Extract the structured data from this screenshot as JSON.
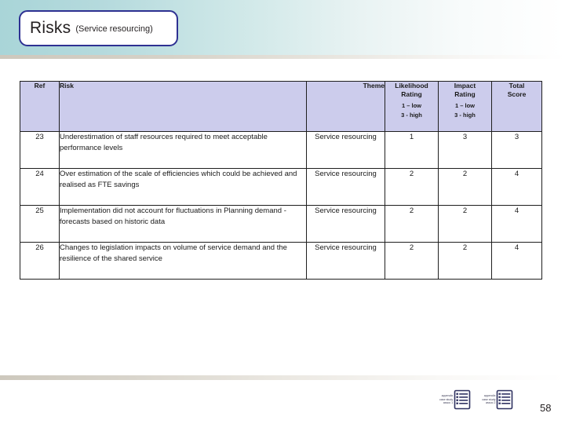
{
  "slide": {
    "title_main": "Risks",
    "title_sub": "(Service resourcing)",
    "page_number": "58",
    "accent_border": "#2e3192",
    "header_gradient_start": "#a9d5d8",
    "table_header_fill": "#ccccec"
  },
  "table": {
    "columns": [
      {
        "key": "ref",
        "label": "Ref"
      },
      {
        "key": "risk",
        "label": "Risk"
      },
      {
        "key": "theme",
        "label": "Theme"
      },
      {
        "key": "likelihood",
        "label_line1": "Likelihood",
        "label_line2": "Rating",
        "scale_low": "1 – low",
        "scale_high": "3 - high"
      },
      {
        "key": "impact",
        "label_line1": "Impact",
        "label_line2": "Rating",
        "scale_low": "1 – low",
        "scale_high": "3 - high"
      },
      {
        "key": "total",
        "label_line1": "Total",
        "label_line2": "Score"
      }
    ],
    "rows": [
      {
        "ref": "23",
        "risk": "Underestimation of staff resources required to meet acceptable performance levels",
        "theme": "Service resourcing",
        "likelihood": "1",
        "impact": "3",
        "total": "3"
      },
      {
        "ref": "24",
        "risk": "Over estimation of the scale of efficiencies which could be achieved and realised as FTE savings",
        "theme": "Service resourcing",
        "likelihood": "2",
        "impact": "2",
        "total": "4"
      },
      {
        "ref": "25",
        "risk": "Implementation did not account for fluctuations in Planning demand - forecasts based on historic data",
        "theme": "Service resourcing",
        "likelihood": "2",
        "impact": "2",
        "total": "4"
      },
      {
        "ref": "26",
        "risk": "Changes to legislation impacts on volume of service demand and the resilience of the shared service",
        "theme": "Service resourcing",
        "likelihood": "2",
        "impact": "2",
        "total": "4"
      }
    ]
  },
  "footer": {
    "attachments": [
      {
        "line1": "appendix",
        "line2": "case study",
        "line3": "assoc 1"
      },
      {
        "line1": "appendix",
        "line2": "case study",
        "line3": "assoc 2"
      }
    ]
  }
}
